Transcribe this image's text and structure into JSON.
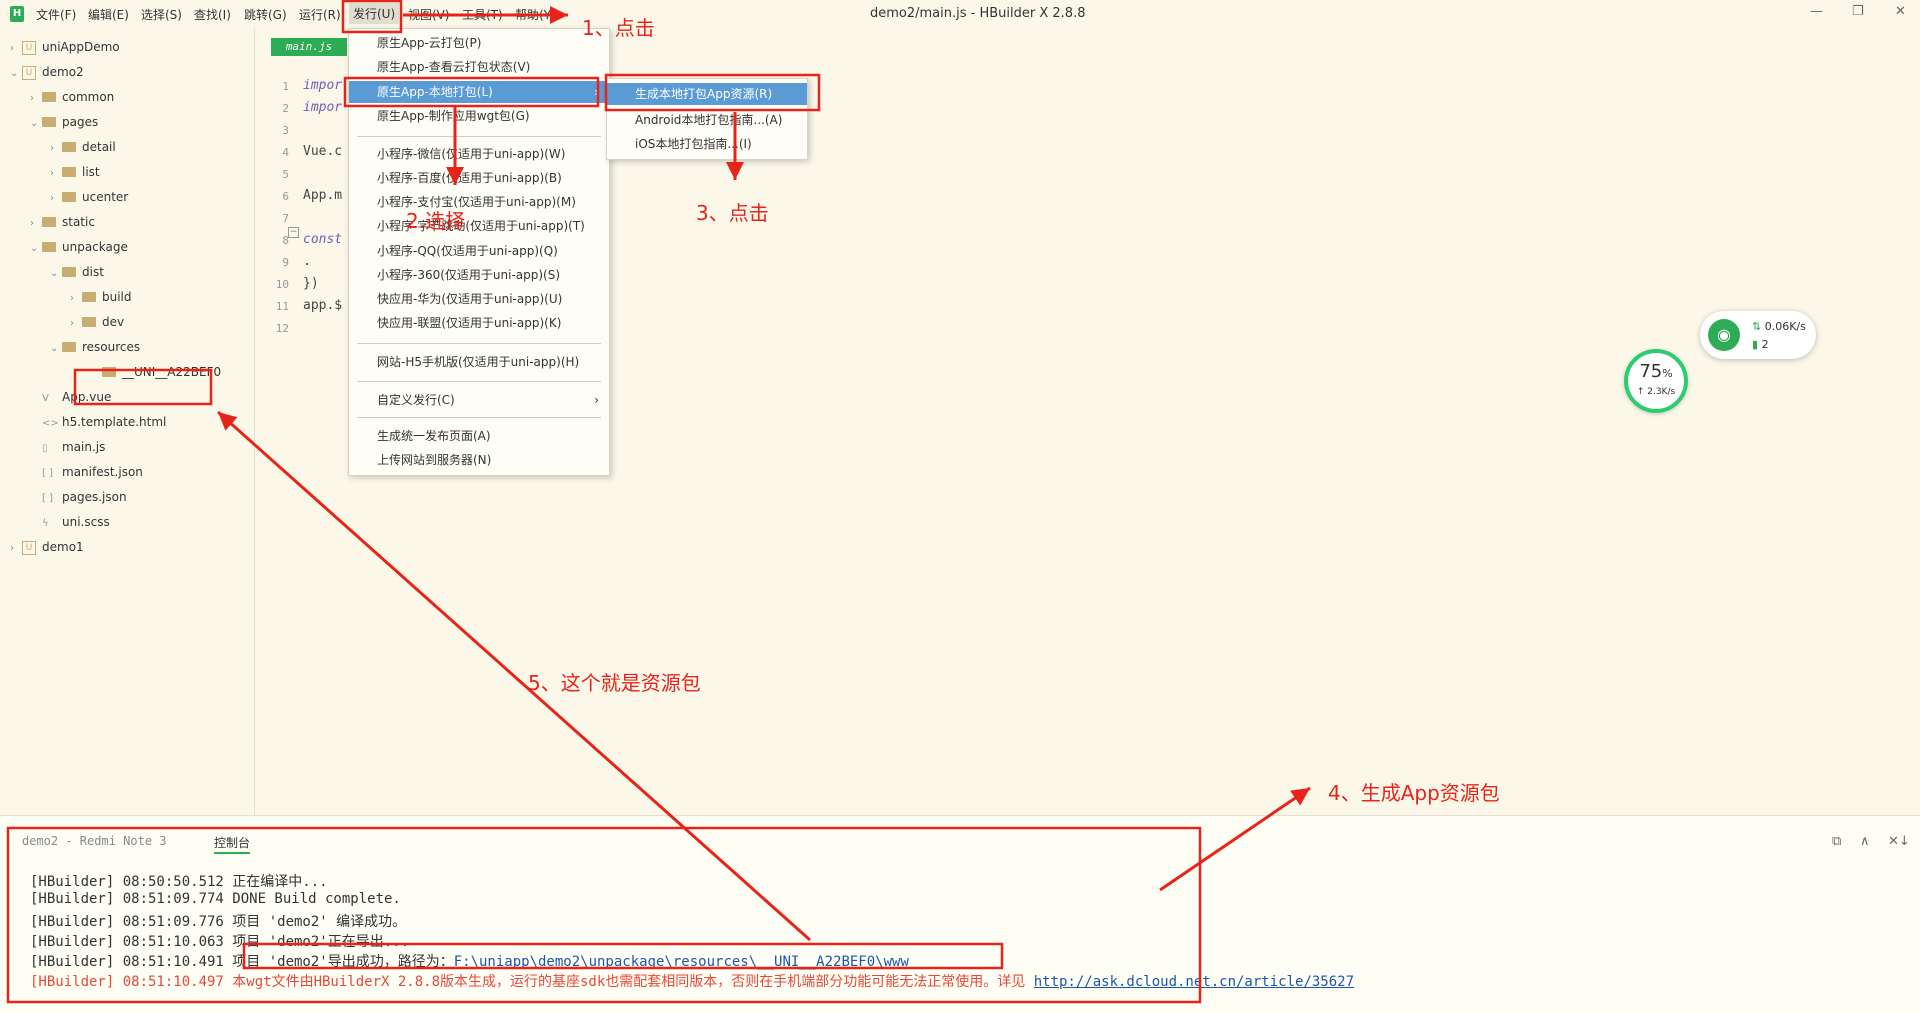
{
  "menubar": {
    "items": [
      "文件(F)",
      "编辑(E)",
      "选择(S)",
      "查找(I)",
      "跳转(G)",
      "运行(R)",
      "发行(U)",
      "视图(V)",
      "工具(T)",
      "帮助(Y)"
    ],
    "title": "demo2/main.js - HBuilder X 2.8.8",
    "logo": "H"
  },
  "tree": [
    {
      "label": "uniAppDemo",
      "type": "project",
      "chev": "›"
    },
    {
      "label": "demo2",
      "type": "project",
      "chev": "⌄"
    },
    {
      "label": "common",
      "type": "folder",
      "chev": "›"
    },
    {
      "label": "pages",
      "type": "folder",
      "chev": "⌄"
    },
    {
      "label": "detail",
      "type": "folder",
      "chev": "›"
    },
    {
      "label": "list",
      "type": "folder",
      "chev": "›"
    },
    {
      "label": "ucenter",
      "type": "folder",
      "chev": "›"
    },
    {
      "label": "static",
      "type": "folder",
      "chev": "›"
    },
    {
      "label": "unpackage",
      "type": "folder",
      "chev": "⌄"
    },
    {
      "label": "dist",
      "type": "folder",
      "chev": "⌄"
    },
    {
      "label": "build",
      "type": "folder",
      "chev": "›"
    },
    {
      "label": "dev",
      "type": "folder",
      "chev": "›"
    },
    {
      "label": "resources",
      "type": "folder",
      "chev": "⌄"
    },
    {
      "label": "__UNI__A22BEF0",
      "type": "folder",
      "chev": ""
    },
    {
      "label": "App.vue",
      "type": "file",
      "icon": "V"
    },
    {
      "label": "h5.template.html",
      "type": "file",
      "icon": "<>"
    },
    {
      "label": "main.js",
      "type": "file",
      "icon": "▯"
    },
    {
      "label": "manifest.json",
      "type": "file",
      "icon": "[ ]"
    },
    {
      "label": "pages.json",
      "type": "file",
      "icon": "[ ]"
    },
    {
      "label": "uni.scss",
      "type": "file",
      "icon": "ϟ"
    },
    {
      "label": "demo1",
      "type": "project",
      "chev": "›"
    }
  ],
  "editor": {
    "tab": "main.js",
    "lines": [
      {
        "n": "1",
        "code": "impor"
      },
      {
        "n": "2",
        "code": "impor"
      },
      {
        "n": "3",
        "code": ""
      },
      {
        "n": "4",
        "code": "Vue.c"
      },
      {
        "n": "5",
        "code": ""
      },
      {
        "n": "6",
        "code": "App.m"
      },
      {
        "n": "7",
        "code": ""
      },
      {
        "n": "8",
        "code": "const"
      },
      {
        "n": "9",
        "code": "   ."
      },
      {
        "n": "10",
        "code": "})"
      },
      {
        "n": "11",
        "code": "app.$"
      },
      {
        "n": "12",
        "code": ""
      }
    ]
  },
  "dropdown": {
    "items": [
      "原生App-云打包(P)",
      "原生App-查看云打包状态(V)",
      "原生App-本地打包(L)",
      "原生App-制作应用wgt包(G)",
      "小程序-微信(仅适用于uni-app)(W)",
      "小程序-百度(仅适用于uni-app)(B)",
      "小程序-支付宝(仅适用于uni-app)(M)",
      "小程序-字节跳动(仅适用于uni-app)(T)",
      "小程序-QQ(仅适用于uni-app)(Q)",
      "小程序-360(仅适用于uni-app)(S)",
      "快应用-华为(仅适用于uni-app)(U)",
      "快应用-联盟(仅适用于uni-app)(K)",
      "网站-H5手机版(仅适用于uni-app)(H)",
      "自定义发行(C)",
      "生成统一发布页面(A)",
      "上传网站到服务器(N)"
    ],
    "submenu": [
      "生成本地打包App资源(R)",
      "Android本地打包指南...(A)",
      "iOS本地打包指南...(I)"
    ]
  },
  "console": {
    "tab_device": "demo2 - Redmi Note 3",
    "tab_console": "控制台",
    "logs": [
      {
        "text": "[HBuilder] 08:50:50.512 正在编译中...",
        "red": false
      },
      {
        "text": "[HBuilder] 08:51:09.774  DONE  Build complete.",
        "red": false
      },
      {
        "text": "[HBuilder] 08:51:09.776 项目 'demo2' 编译成功。",
        "red": false
      },
      {
        "text": "[HBuilder] 08:51:10.063 项目 'demo2'正在导出...",
        "red": false
      },
      {
        "text": "[HBuilder] 08:51:10.491 项目 'demo2'导出成功，路径为：",
        "red": false
      },
      {
        "text": "[HBuilder] 08:51:10.497 本wgt文件由HBuilderX 2.8.8版本生成，运行的基座sdk也需配套相同版本，否则在手机端部分功能可能无法正常使用。详见 ",
        "red": true
      }
    ],
    "path_link": "F:\\uniapp\\demo2\\unpackage\\resources\\__UNI__A22BEF0\\www",
    "article_link": "http://ask.dcloud.net.cn/article/35627"
  },
  "widgets": {
    "net_speed_down": "0.06K/s",
    "net_count": "2",
    "gauge_value": "75",
    "gauge_unit": "%",
    "gauge_speed": "↑ 2.3K/s"
  },
  "annotations": {
    "a1": "1、点击",
    "a2": "2.选择",
    "a3": "3、点击",
    "a4": "4、生成App资源包",
    "a5": "5、这个就是资源包"
  },
  "colors": {
    "accent": "#2eab55",
    "highlight": "#5b9bd5",
    "annotation": "#e8231a",
    "background": "#fbf8ea"
  }
}
